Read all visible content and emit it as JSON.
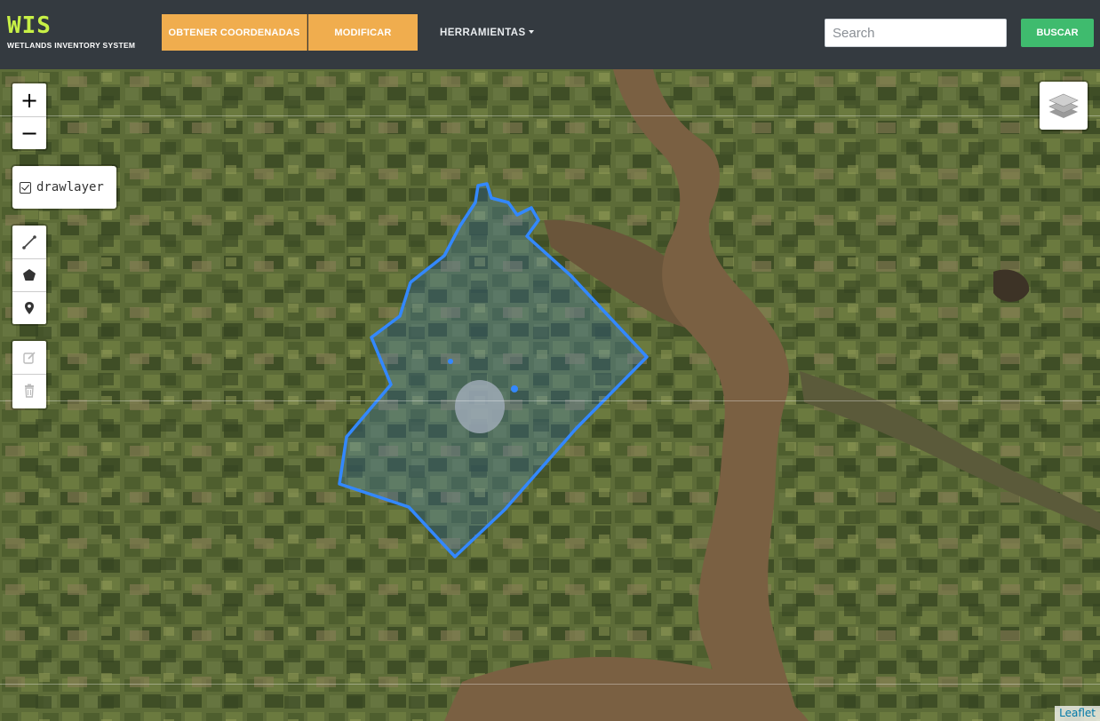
{
  "navbar": {
    "brand_title": "WIS",
    "brand_subtitle": "WETLANDS INVENTORY SYSTEM",
    "buttons": [
      {
        "label": "OBTENER COORDENADAS"
      },
      {
        "label": "MODIFICAR"
      }
    ],
    "dropdown_label": "HERRAMIENTAS",
    "search": {
      "placeholder": "Search",
      "value": ""
    },
    "search_button": "BUSCAR",
    "colors": {
      "bg": "#343a40",
      "brand": "#c8f046",
      "accent": "#f0ad4e",
      "search_btn": "#3fbb6e"
    }
  },
  "map": {
    "zoom_in": "+",
    "zoom_out": "−",
    "layer_control": {
      "checked": true,
      "label": "drawlayer"
    },
    "draw_tools": [
      "polyline-icon",
      "polygon-icon",
      "marker-icon"
    ],
    "edit_tools": [
      "edit-icon",
      "trash-icon"
    ],
    "layers_icon": "layers-icon",
    "attribution": "Leaflet",
    "polygon_color": "#3388ff"
  }
}
